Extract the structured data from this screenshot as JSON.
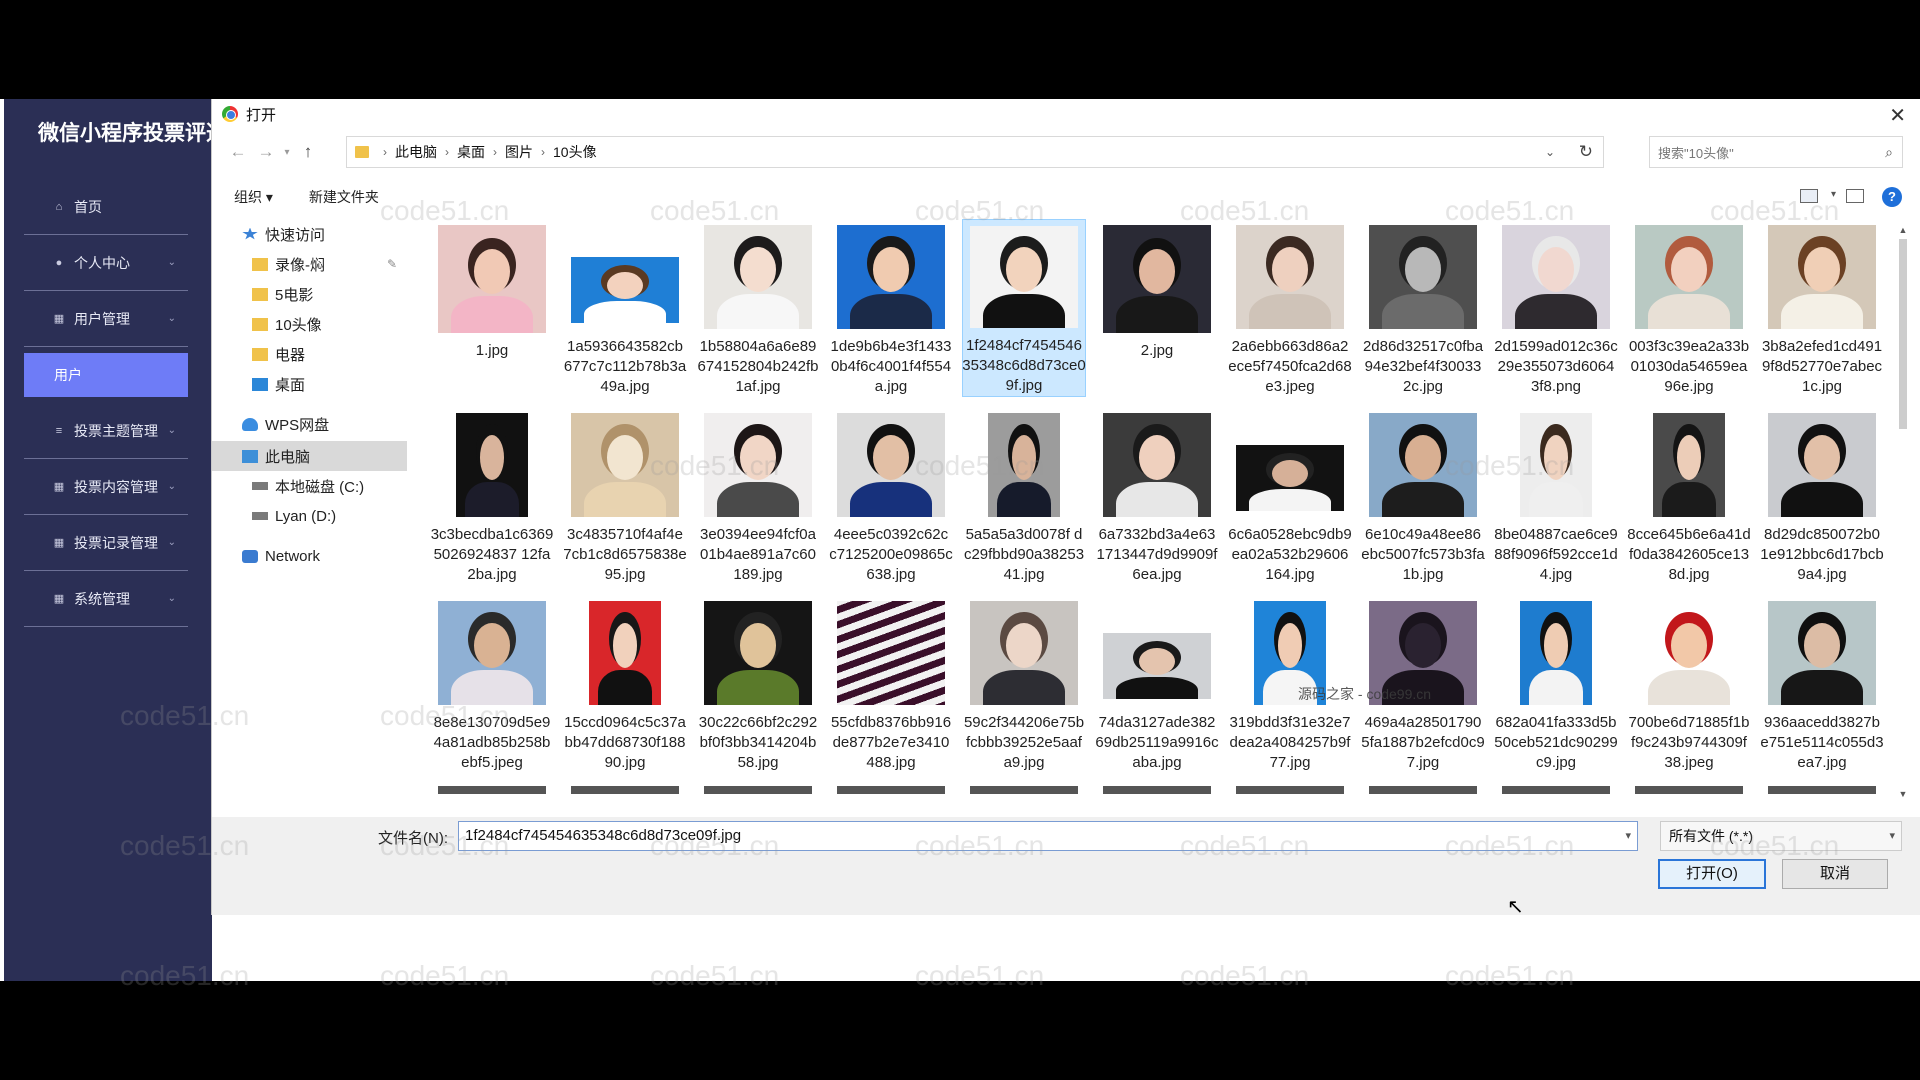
{
  "admin": {
    "title": "微信小程序投票评选",
    "menu": [
      {
        "label": "首页",
        "icon": "home-icon"
      },
      {
        "label": "个人中心",
        "icon": "person-icon"
      },
      {
        "label": "用户管理",
        "icon": "grid-icon"
      },
      {
        "label": "用户",
        "icon": ""
      },
      {
        "label": "投票主题管理",
        "icon": "list-icon"
      },
      {
        "label": "投票内容管理",
        "icon": "grid-icon"
      },
      {
        "label": "投票记录管理",
        "icon": "grid-icon"
      },
      {
        "label": "系统管理",
        "icon": "grid-icon"
      }
    ]
  },
  "dialog": {
    "title": "打开",
    "breadcrumb": [
      "此电脑",
      "桌面",
      "图片",
      "10头像"
    ],
    "search_placeholder": "搜索\"10头像\"",
    "toolbar": {
      "organize": "组织 ▾",
      "new_folder": "新建文件夹"
    },
    "nav": [
      {
        "label": "快速访问",
        "icon": "star-icon",
        "indent": 1
      },
      {
        "label": "录像-焖",
        "icon": "folder-icon",
        "indent": 2,
        "pinned": true
      },
      {
        "label": "5电影",
        "icon": "folder-icon",
        "indent": 2
      },
      {
        "label": "10头像",
        "icon": "folder-icon",
        "indent": 2
      },
      {
        "label": "电器",
        "icon": "folder-icon",
        "indent": 2
      },
      {
        "label": "桌面",
        "icon": "desktop-icon",
        "indent": 2
      },
      {
        "label": "WPS网盘",
        "icon": "cloud-icon",
        "indent": 1
      },
      {
        "label": "此电脑",
        "icon": "pc-icon",
        "indent": 1,
        "selected": true
      },
      {
        "label": "本地磁盘 (C:)",
        "icon": "drive-icon",
        "indent": 2
      },
      {
        "label": "Lyan (D:)",
        "icon": "drive-icon",
        "indent": 2
      },
      {
        "label": "Network",
        "icon": "network-icon",
        "indent": 1
      }
    ],
    "files": [
      {
        "name": "1.jpg",
        "bg": "#e9c7c5",
        "skin": "#f1c9b5",
        "hair": "#3a2420",
        "cloth": "#f3b5c6"
      },
      {
        "name": "1a5936643582cb677c7c112b78b3a49a.jpg",
        "bg": "#1f7fd6",
        "skin": "#f3d2be",
        "hair": "#5a3a22",
        "cloth": "#ffffff",
        "short": true
      },
      {
        "name": "1b58804a6a6e89674152804b242fb1af.jpg",
        "bg": "#e8e6e2",
        "skin": "#f4ddcf",
        "hair": "#1d1b1b",
        "cloth": "#f7f7f7"
      },
      {
        "name": "1de9b6b4e3f14330b4f6c4001f4f554a.jpg",
        "bg": "#1d6ed0",
        "skin": "#f0cbb0",
        "hair": "#1a1a1a",
        "cloth": "#1b2a48"
      },
      {
        "name": "1f2484cf745454635348c6d8d73ce09f.jpg",
        "bg": "#f3f3f3",
        "skin": "#f2d3bd",
        "hair": "#1c1c1c",
        "cloth": "#111111",
        "selected": true
      },
      {
        "name": "2.jpg",
        "bg": "#2a2a35",
        "skin": "#e1b79f",
        "hair": "#111",
        "cloth": "#181818"
      },
      {
        "name": "2a6ebb663d86a2ece5f7450fca2d68e3.jpeg",
        "bg": "#dcd3cb",
        "skin": "#eed0bf",
        "hair": "#3b2a22",
        "cloth": "#cfc3b8"
      },
      {
        "name": "2d86d32517c0fba94e32bef4f300332c.jpg",
        "bg": "#4f4f4f",
        "skin": "#b8b8b8",
        "hair": "#222",
        "cloth": "#6b6b6b"
      },
      {
        "name": "2d1599ad012c36c29e355073d60643f8.png",
        "bg": "#d9d4dd",
        "skin": "#f1d8d0",
        "hair": "#e8e8e8",
        "cloth": "#2e2a2f"
      },
      {
        "name": "003f3c39ea2a33b01030da54659ea96e.jpg",
        "bg": "#b9c9c3",
        "skin": "#f2d0bf",
        "hair": "#b15b3e",
        "cloth": "#e8e0d6"
      },
      {
        "name": "3b8a2efed1cd4919f8d52770e7abec1c.jpg",
        "bg": "#d4c8b8",
        "skin": "#f0cfb6",
        "hair": "#6b4124",
        "cloth": "#f4f0e6"
      },
      {
        "name": "3c3becdba1c63695026924837 12fa2ba.jpg",
        "bg": "#111111",
        "skin": "#d9b49c",
        "hair": "#111",
        "cloth": "#1c1c2a",
        "narrow": true
      },
      {
        "name": "3c4835710f4af4e7cb1c8d6575838e95.jpg",
        "bg": "#d8c5a8",
        "skin": "#f2e5d0",
        "hair": "#b0926a",
        "cloth": "#e8d3b0"
      },
      {
        "name": "3e0394ee94fcf0a01b4ae891a7c60189.jpg",
        "bg": "#f0eeee",
        "skin": "#f1d6c6",
        "hair": "#1d1616",
        "cloth": "#4a4a4a"
      },
      {
        "name": "4eee5c0392c62c c7125200e09865c638.jpg",
        "bg": "#dcdcdc",
        "skin": "#e2bfa5",
        "hair": "#111",
        "cloth": "#17317c"
      },
      {
        "name": "5a5a5a3d0078f dc29fbbd90a3825341.jpg",
        "bg": "#9c9c9c",
        "skin": "#d8b39a",
        "hair": "#111",
        "cloth": "#161b2b",
        "narrow": true
      },
      {
        "name": "6a7332bd3a4e631713447d9d9909f6ea.jpg",
        "bg": "#3b3b3b",
        "skin": "#efd0be",
        "hair": "#1a1a1a",
        "cloth": "#e7e7e7"
      },
      {
        "name": "6c6a0528ebc9db9ea02a532b29606164.jpg",
        "bg": "#121212",
        "skin": "#d6b098",
        "hair": "#222",
        "cloth": "#f4f4f4",
        "short": true
      },
      {
        "name": "6e10c49a48ee86ebc5007fc573b3fa1b.jpg",
        "bg": "#88a9c8",
        "skin": "#d8af92",
        "hair": "#111",
        "cloth": "#1d1d1d"
      },
      {
        "name": "8be04887cae6ce988f9096f592cce1d4.jpg",
        "bg": "#ededed",
        "skin": "#f0d3c0",
        "hair": "#3b2a1e",
        "cloth": "#efefef",
        "narrow": true
      },
      {
        "name": "8cce645b6e6a41df0da3842605ce138d.jpg",
        "bg": "#4a4a4a",
        "skin": "#eccdb8",
        "hair": "#141414",
        "cloth": "#1b1b1b",
        "narrow": true
      },
      {
        "name": "8d29dc850072b01e912bbc6d17bcb9a4.jpg",
        "bg": "#c9cbcf",
        "skin": "#e2c0a8",
        "hair": "#111",
        "cloth": "#111"
      },
      {
        "name": "8e8e130709d5e94a81adb85b258bebf5.jpeg",
        "bg": "#8fb0d4",
        "skin": "#d9b293",
        "hair": "#2a2a2a",
        "cloth": "#e6e1e8"
      },
      {
        "name": "15ccd0964c5c37abb47dd68730f18890.jpg",
        "bg": "#d9262a",
        "skin": "#f1d1bc",
        "hair": "#171717",
        "cloth": "#111",
        "narrow": true
      },
      {
        "name": "30c22c66bf2c292bf0f3bb3414204b58.jpg",
        "bg": "#151515",
        "skin": "#e0c39a",
        "hair": "#222",
        "cloth": "#5a7a2a"
      },
      {
        "name": "55cfdb8376bb916de877b2e7e3410488.jpg",
        "bg": "#f2f2f2",
        "skin": "#3a0f2a",
        "hair": "#3a0f2a",
        "cloth": "#3a0f2a",
        "stripes": true
      },
      {
        "name": "59c2f344206e75bfcbbb39252e5aafa9.jpg",
        "bg": "#c8c4c0",
        "skin": "#ecd6c8",
        "hair": "#5b4a42",
        "cloth": "#2d2d33"
      },
      {
        "name": "74da3127ade38269db25119a9916caba.jpg",
        "bg": "#cfd1d4",
        "skin": "#e4c4ae",
        "hair": "#1a1a1a",
        "cloth": "#111",
        "short": true
      },
      {
        "name": "319bdd3f31e32e7dea2a4084257b9f77.jpg",
        "bg": "#1f84d8",
        "skin": "#f0ccb4",
        "hair": "#111",
        "cloth": "#f5f5f5",
        "narrow": true
      },
      {
        "name": "469a4a285017905fa1887b2efcd0c97.jpg",
        "bg": "#7b6b87",
        "skin": "#2a2230",
        "hair": "#1a141d",
        "cloth": "#1a141d"
      },
      {
        "name": "682a041fa333d5b50ceb521dc90299c9.jpg",
        "bg": "#1e7ccf",
        "skin": "#efccb3",
        "hair": "#111",
        "cloth": "#f3f3f3",
        "narrow": true
      },
      {
        "name": "700be6d71885f1bf9c243b9744309f38.jpeg",
        "bg": "#ffffff",
        "skin": "#f2c8a8",
        "hair": "#c2171b",
        "cloth": "#e8e2da"
      },
      {
        "name": "936aacedd3827be751e5114c055d3ea7.jpg",
        "bg": "#b7c6c8",
        "skin": "#dcbca5",
        "hair": "#101010",
        "cloth": "#171717"
      }
    ],
    "filename_label": "文件名(N):",
    "filename_value": "1f2484cf745454635348c6d8d73ce09f.jpg",
    "filetype": "所有文件 (*.*)",
    "open_label": "打开(O)",
    "cancel_label": "取消",
    "overlay_text": "源码之家 - code99.cn"
  },
  "watermark": "code51.cn"
}
